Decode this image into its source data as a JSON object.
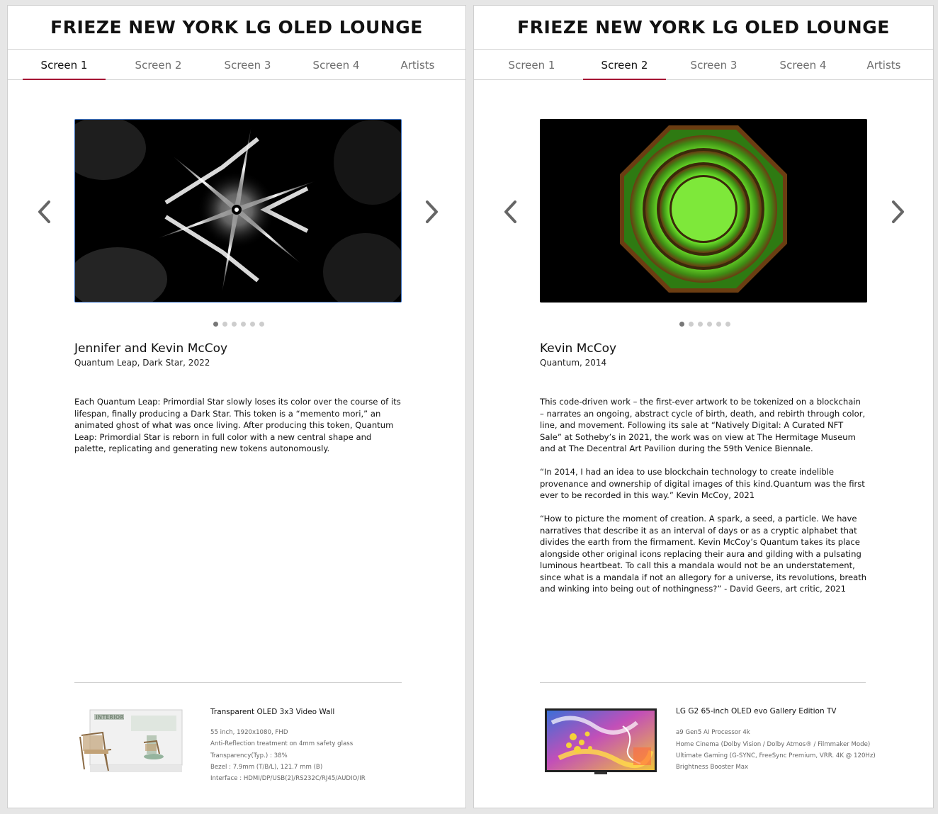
{
  "left": {
    "title": "FRIEZE NEW YORK LG OLED LOUNGE",
    "tabs": [
      "Screen 1",
      "Screen 2",
      "Screen 3",
      "Screen 4",
      "Artists"
    ],
    "active_tab": 0,
    "carousel": {
      "dots": 6,
      "active_dot": 0
    },
    "artist": "Jennifer and Kevin McCoy",
    "work": "Quantum Leap, Dark Star, 2022",
    "description": [
      "Each Quantum Leap: Primordial Star slowly loses its color over the course of its lifespan, finally producing a Dark Star. This token is a “memento mori,” an animated ghost of what was once living. After producing this token, Quantum Leap: Primordial Star is reborn in full color with a new central shape and palette, replicating and generating new tokens autonomously."
    ],
    "product": {
      "name": "Transparent OLED 3x3 Video Wall",
      "image_text": "INTERIOR",
      "specs": [
        "55 inch, 1920x1080, FHD",
        "Anti-Reflection treatment on 4mm safety glass",
        "Transparency(Typ.) : 38%",
        "Bezel : 7.9mm (T/B/L), 121.7 mm (B)",
        "Interface : HDMI/DP/USB(2)/RS232C/RJ45/AUDIO/IR"
      ]
    }
  },
  "right": {
    "title": "FRIEZE NEW YORK LG OLED LOUNGE",
    "tabs": [
      "Screen 1",
      "Screen 2",
      "Screen 3",
      "Screen 4",
      "Artists"
    ],
    "active_tab": 1,
    "carousel": {
      "dots": 6,
      "active_dot": 0
    },
    "artist": "Kevin McCoy",
    "work": "Quantum, 2014",
    "description": [
      "This code-driven work – the first-ever artwork to be tokenized on a blockchain – narrates an ongoing, abstract cycle of birth, death, and rebirth through color, line, and movement. Following its sale at “Natively Digital: A Curated NFT Sale” at Sotheby’s in 2021, the work was on view at The Hermitage Museum and at The Decentral Art Pavilion during the 59th Venice Biennale.",
      "“In 2014, I had an idea to use blockchain technology to create indelible provenance and ownership of digital images of this kind.Quantum was the first ever to be recorded in this way.” Kevin McCoy, 2021",
      "“How to picture the moment of creation. A spark, a seed, a particle. We have narratives that describe it as an interval of days or as a cryptic alphabet that divides the earth from the firmament. Kevin McCoy’s Quantum takes its place alongside other original icons replacing their aura and gilding with a pulsating luminous heartbeat. To call this a mandala would not be an understatement, since what is a mandala if not an allegory for a universe, its revolutions, breath and winking into being out of nothingness?” - David Geers, art critic, 2021"
    ],
    "product": {
      "name": "LG G2 65-inch OLED evo Gallery Edition TV",
      "specs": [
        "a9 Gen5 AI Processor 4k",
        "Home Cinema (Dolby Vision / Dolby Atmos® / Filmmaker Mode)",
        "Ultimate Gaming (G-SYNC, FreeSync Premium, VRR. 4K @ 120Hz)",
        "Brightness Booster Max"
      ]
    }
  },
  "colors": {
    "accent": "#a50034",
    "selection": "#3a6fc0",
    "green": "#7ee83a"
  },
  "icons": [
    "chevron-left-icon",
    "chevron-right-icon"
  ]
}
